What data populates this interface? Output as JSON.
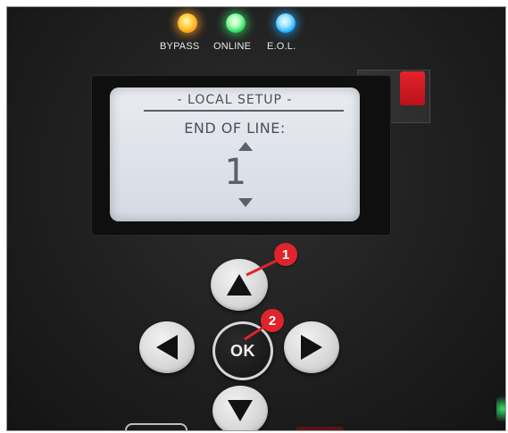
{
  "leds": {
    "bypass": {
      "label": "BYPASS",
      "color": "#ffb52e"
    },
    "online": {
      "label": "ONLINE",
      "color": "#25d65a"
    },
    "eol": {
      "label": "E.O.L.",
      "color": "#19a9ff"
    }
  },
  "lcd": {
    "title": "- LOCAL SETUP -",
    "label": "END OF LINE:",
    "value": "1"
  },
  "keypad": {
    "ok_label": "OK"
  },
  "markers": {
    "m1": "1",
    "m2": "2",
    "color": "#e0242b"
  }
}
